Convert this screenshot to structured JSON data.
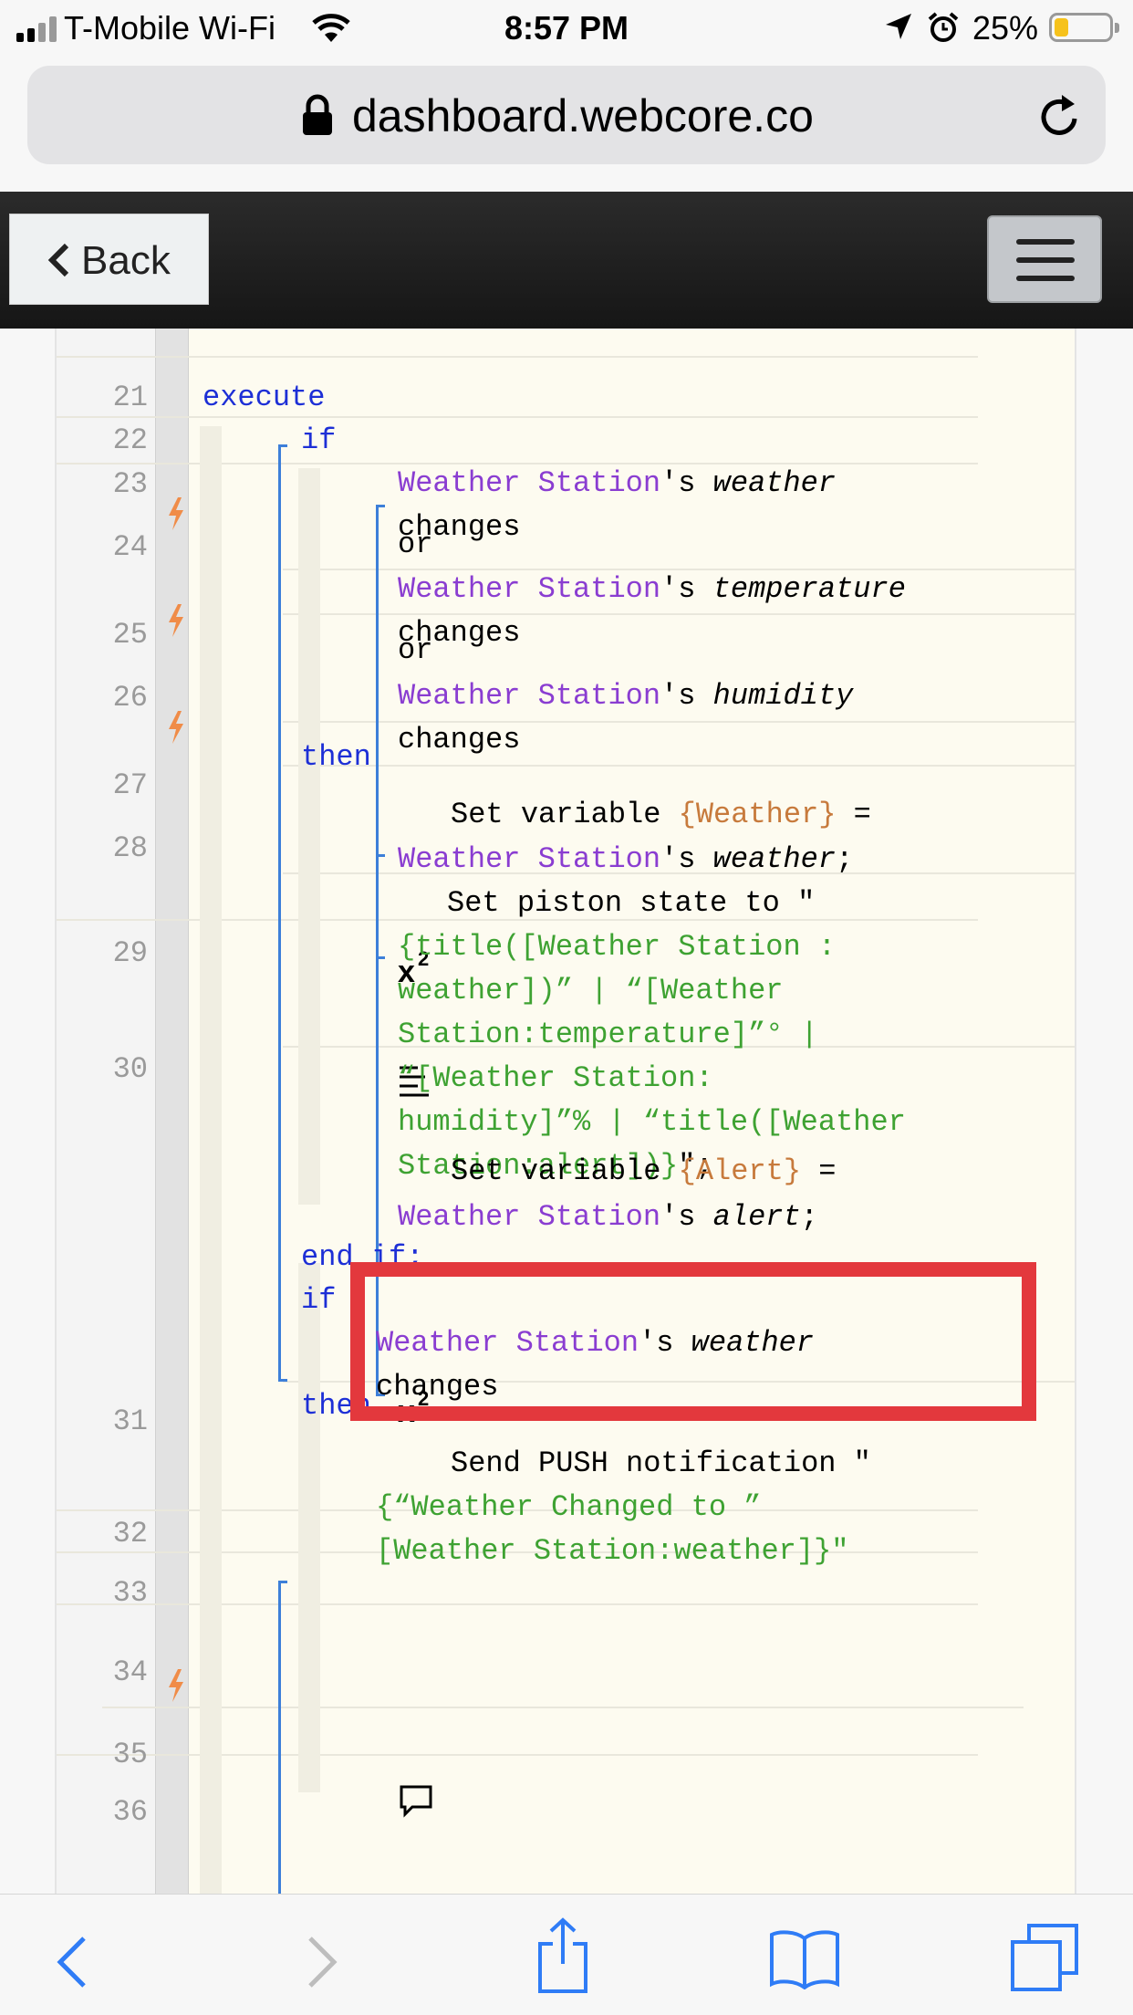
{
  "status_bar": {
    "carrier": "T-Mobile Wi-Fi",
    "time": "8:57 PM",
    "battery": "25%",
    "battery_level": 0.25
  },
  "browser": {
    "url": "dashboard.webcore.co"
  },
  "nav": {
    "back_label": "Back"
  },
  "code": {
    "lines": [
      {
        "n": "21",
        "parts": [
          {
            "t": "execute",
            "c": "kw"
          }
        ]
      },
      {
        "n": "22",
        "parts": [
          {
            "t": "if",
            "c": "kw"
          }
        ]
      },
      {
        "n": "23",
        "parts": [
          {
            "t": "Weather Station",
            "c": "dev"
          },
          {
            "t": "'s ",
            "c": ""
          },
          {
            "t": "weather",
            "c": "it"
          }
        ]
      },
      {
        "n": "",
        "parts": [
          {
            "t": "changes",
            "c": ""
          }
        ]
      },
      {
        "n": "24",
        "parts": [
          {
            "t": "or",
            "c": ""
          }
        ]
      },
      {
        "n": "25",
        "parts": [
          {
            "t": "Weather Station",
            "c": "dev"
          },
          {
            "t": "'s ",
            "c": ""
          },
          {
            "t": "temperature",
            "c": "it"
          }
        ]
      },
      {
        "n": "",
        "parts": [
          {
            "t": "changes",
            "c": ""
          }
        ]
      },
      {
        "n": "26",
        "parts": [
          {
            "t": "or",
            "c": ""
          }
        ]
      },
      {
        "n": "27",
        "parts": [
          {
            "t": "Weather Station",
            "c": "dev"
          },
          {
            "t": "'s ",
            "c": ""
          },
          {
            "t": "humidity",
            "c": "it"
          }
        ]
      },
      {
        "n": "",
        "parts": [
          {
            "t": "changes",
            "c": ""
          }
        ]
      },
      {
        "n": "28",
        "parts": [
          {
            "t": "then",
            "c": "kw"
          }
        ]
      },
      {
        "n": "29",
        "parts": [
          {
            "t": "Set variable ",
            "c": ""
          },
          {
            "t": "{Weather}",
            "c": "var"
          },
          {
            "t": " =",
            "c": ""
          }
        ]
      },
      {
        "n": "",
        "parts": [
          {
            "t": "Weather Station",
            "c": "dev"
          },
          {
            "t": "'s ",
            "c": ""
          },
          {
            "t": "weather",
            "c": "it"
          },
          {
            "t": ";",
            "c": ""
          }
        ]
      },
      {
        "n": "30",
        "parts": [
          {
            "t": "Set piston state to \"",
            "c": ""
          }
        ]
      },
      {
        "n": "",
        "parts": [
          {
            "t": "{title([Weather Station :",
            "c": "str"
          }
        ]
      },
      {
        "n": "",
        "parts": [
          {
            "t": "weather])” | “[Weather",
            "c": "str"
          }
        ]
      },
      {
        "n": "",
        "parts": [
          {
            "t": "Station:temperature]”° |",
            "c": "str"
          }
        ]
      },
      {
        "n": "",
        "parts": [
          {
            "t": "“[Weather Station:",
            "c": "str"
          }
        ]
      },
      {
        "n": "",
        "parts": [
          {
            "t": "humidity]”% | “title([Weather",
            "c": "str"
          }
        ]
      },
      {
        "n": "",
        "parts": [
          {
            "t": "Station:alert])}",
            "c": "str"
          },
          {
            "t": "\";",
            "c": ""
          }
        ]
      },
      {
        "n": "31",
        "parts": [
          {
            "t": "Set variable ",
            "c": ""
          },
          {
            "t": "{Alert}",
            "c": "var"
          },
          {
            "t": " =",
            "c": ""
          }
        ]
      },
      {
        "n": "",
        "parts": [
          {
            "t": "Weather Station",
            "c": "dev"
          },
          {
            "t": "'s ",
            "c": ""
          },
          {
            "t": "alert",
            "c": "it"
          },
          {
            "t": ";",
            "c": ""
          }
        ]
      },
      {
        "n": "32",
        "parts": [
          {
            "t": "end if;",
            "c": "kw"
          }
        ]
      },
      {
        "n": "33",
        "parts": [
          {
            "t": "if",
            "c": "kw"
          }
        ]
      },
      {
        "n": "34",
        "parts": [
          {
            "t": "Weather Station",
            "c": "dev"
          },
          {
            "t": "'s ",
            "c": ""
          },
          {
            "t": "weather",
            "c": "it"
          }
        ]
      },
      {
        "n": "",
        "parts": [
          {
            "t": "changes",
            "c": ""
          }
        ]
      },
      {
        "n": "35",
        "parts": [
          {
            "t": "then",
            "c": "kw"
          }
        ]
      },
      {
        "n": "36",
        "parts": [
          {
            "t": "Send PUSH notification \"",
            "c": ""
          }
        ]
      },
      {
        "n": "",
        "parts": [
          {
            "t": "{“Weather Changed to ”",
            "c": "str"
          }
        ]
      },
      {
        "n": "",
        "parts": [
          {
            "t": "[Weather Station:weather]}\"",
            "c": "str"
          }
        ]
      }
    ]
  },
  "icons": [
    "back-chevron-icon",
    "hamburger-menu-icon",
    "lock-icon",
    "reload-icon",
    "trigger-bolt-icon",
    "set-variable-icon",
    "piston-state-icon",
    "push-notification-icon",
    "nav-back-icon",
    "nav-forward-icon",
    "share-icon",
    "bookmarks-icon",
    "tabs-icon"
  ],
  "colors": {
    "keyword": "#1d2fd6",
    "device": "#8a3dd1",
    "variable": "#c77a3c",
    "string": "#3ea232",
    "highlight": "#e3383d",
    "trigger": "#f08c48"
  }
}
